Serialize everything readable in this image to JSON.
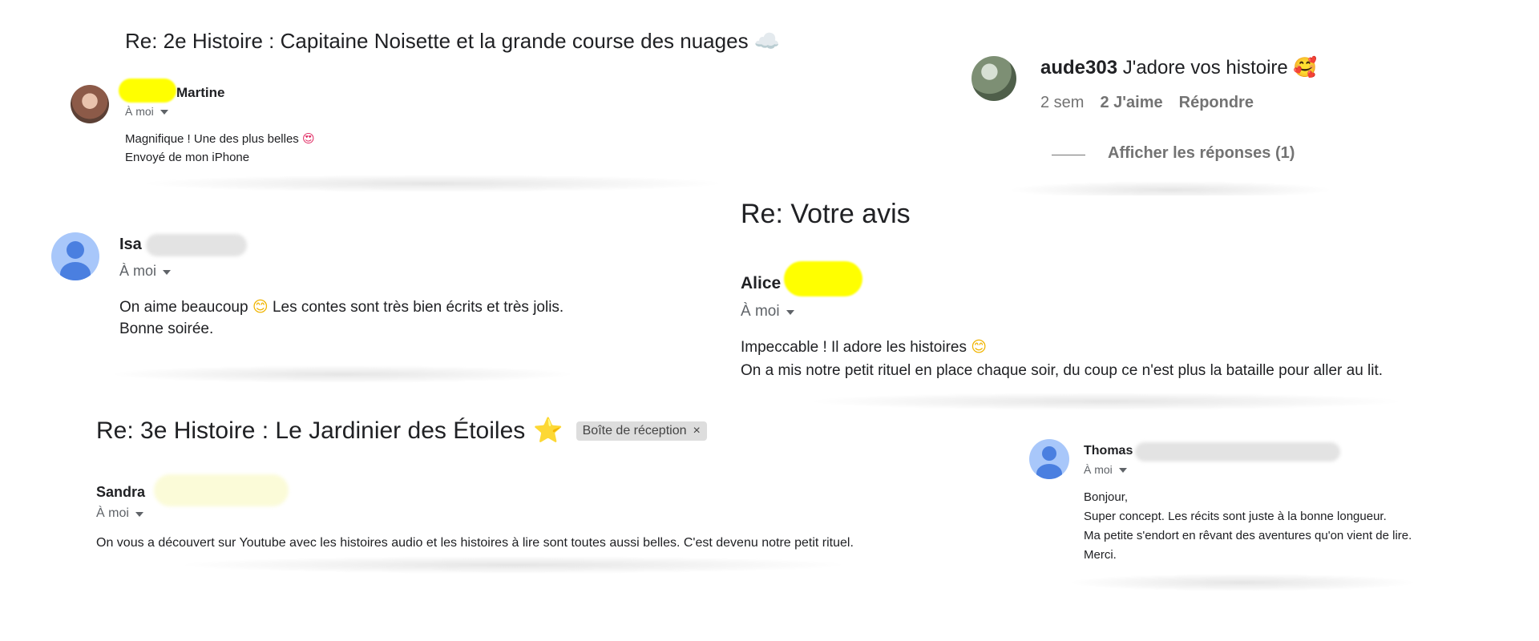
{
  "mail1": {
    "subject": "Re: 2e Histoire : Capitaine Noisette et la grande course des nuages",
    "subject_icon": "cloud-emoji",
    "sender": "Martine",
    "to": "À moi",
    "body": [
      "Magnifique ! Une des plus belles",
      "Envoyé de mon iPhone"
    ],
    "body_emoji": "heart-eyes-emoji"
  },
  "comment": {
    "username": "aude303",
    "text": "J'adore vos histoire",
    "emoji": "smiling-face-with-hearts-emoji",
    "time": "2 sem",
    "likes": "2 J'aime",
    "reply": "Répondre",
    "view_replies": "Afficher les réponses (1)"
  },
  "mail2": {
    "sender": "Isa",
    "to": "À moi",
    "body": [
      "On aime beaucoup",
      "Les contes sont très bien écrits et très jolis.",
      "Bonne soirée."
    ],
    "body_emoji": "smiling-face-emoji"
  },
  "mail3": {
    "subject": "Re: Votre avis",
    "sender": "Alice",
    "to": "À moi",
    "body": [
      "Impeccable ! Il adore les histoires",
      "On a mis notre petit rituel en place chaque soir, du coup ce n'est plus la bataille pour aller au lit."
    ],
    "body_emoji": "smiling-face-emoji"
  },
  "mail4": {
    "subject": "Re: 3e Histoire : Le Jardinier des Étoiles",
    "subject_icon": "star-emoji",
    "badge": "Boîte de réception",
    "badge_close": "×",
    "sender": "Sandra",
    "to": "À moi",
    "body": [
      "On vous a découvert sur Youtube avec les histoires audio et les histoires à lire sont toutes aussi belles. C'est devenu notre petit rituel."
    ]
  },
  "mail5": {
    "sender": "Thomas",
    "to": "À moi",
    "body": [
      "Bonjour,",
      "Super concept. Les récits sont juste à la bonne longueur.",
      "Ma petite s'endort en rêvant des aventures qu'on vient de lire.",
      "Merci."
    ]
  },
  "colors": {
    "highlight_yellow": "#ffff00",
    "avatar_bg": "#a8c7fa",
    "avatar_fg": "#4a7fe0",
    "meta_gray": "#5f6368",
    "badge_bg": "#dddddd"
  }
}
